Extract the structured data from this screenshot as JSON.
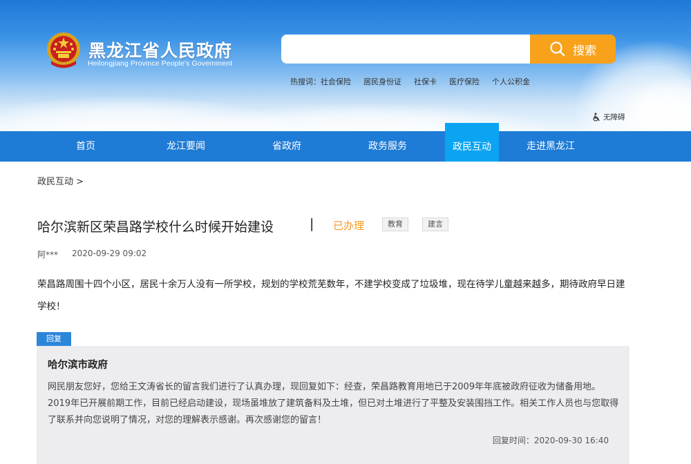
{
  "header": {
    "title_cn": "黑龙江省人民政府",
    "title_en": "Heilongjiang Province People's Government",
    "search_placeholder": "",
    "search_button": "搜索",
    "hot_label": "热搜词：",
    "hot_words": [
      "社会保险",
      "居民身份证",
      "社保卡",
      "医疗保险",
      "个人公积金"
    ],
    "accessibility": "无障碍"
  },
  "nav": {
    "items": [
      "首页",
      "龙江要闻",
      "省政府",
      "政务服务",
      "政民互动",
      "走进黑龙江"
    ],
    "active": "政民互动"
  },
  "breadcrumb": "政民互动 >",
  "question": {
    "title": "哈尔滨新区荣昌路学校什么时候开始建设",
    "separator": "|",
    "status": "已办理",
    "tags": [
      "教育",
      "建言"
    ],
    "author": "阿***",
    "date": "2020-09-29 09:02",
    "content": "荣昌路周围十四个小区，居民十余万人没有一所学校，规划的学校荒芜数年，不建学校变成了垃圾堆，现在待学儿童越来越多，期待政府早日建学校！"
  },
  "reply": {
    "tab_label": "回复",
    "org": "哈尔滨市政府",
    "content": "网民朋友您好，您给王文涛省长的留言我们进行了认真办理，现回复如下：经查，荣昌路教育用地已于2009年年底被政府征收为储备用地。2019年已开展前期工作，目前已经启动建设，现场虽堆放了建筑备料及土堆，但已对土堆进行了平整及安装围挡工作。相关工作人员也与您取得了联系并向您说明了情况，对您的理解表示感谢。再次感谢您的留言！",
    "time": "回复时间：2020-09-30 16:40"
  },
  "colors": {
    "nav_bg": "#1e7bd6",
    "nav_active": "#0aa4f3",
    "search_button": "#f8a21c",
    "status": "#f39a25",
    "reply_tab": "#2b86d9"
  }
}
